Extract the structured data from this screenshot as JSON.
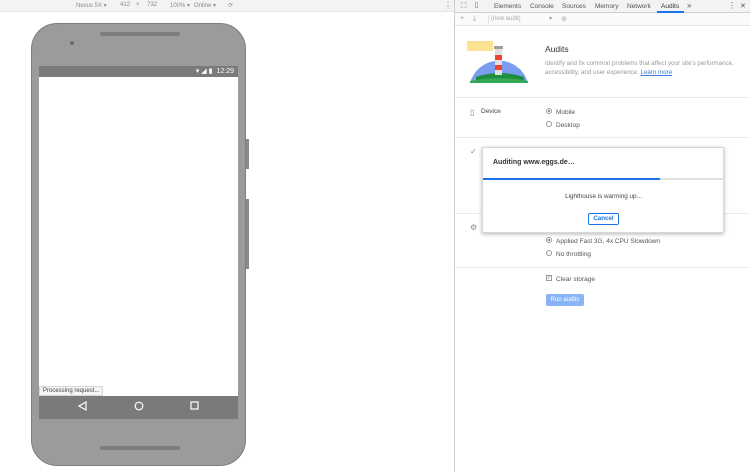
{
  "emulator": {
    "device": "Nexus 5X ▾",
    "width": "412",
    "times": "×",
    "height": "732",
    "zoom": "100% ▾",
    "network": "Online ▾",
    "rotate_icon": "rotate-icon",
    "menu": "⋮"
  },
  "phone": {
    "status_time": "12:29",
    "processing_text": "Processing request..."
  },
  "devtools": {
    "tabs": [
      {
        "label": "Elements"
      },
      {
        "label": "Console"
      },
      {
        "label": "Sources"
      },
      {
        "label": "Memory"
      },
      {
        "label": "Network"
      },
      {
        "label": "Audits"
      }
    ],
    "more_tabs": "»",
    "menu": "⋮",
    "close": "✕",
    "active_tab": "Audits",
    "accent": "#1a73e8"
  },
  "audits": {
    "select_placeholder": "(new audit)",
    "title": "Audits",
    "desc": "Identify and fix common problems that affect your site's performance, accessibility, and user experience.",
    "learn_more": "Learn more",
    "device_label": "Device",
    "device_options": [
      {
        "label": "Mobile",
        "checked": true
      },
      {
        "label": "Desktop",
        "checked": false
      }
    ],
    "throttling_options": [
      {
        "label": "Applied Fast 3G, 4x CPU Slowdown",
        "checked": true
      },
      {
        "label": "No throttling",
        "checked": false
      }
    ],
    "clear_storage": "Clear storage",
    "run_button": "Run audits"
  },
  "dialog": {
    "title": "Auditing www.eggs.de…",
    "message": "Lighthouse is warming up…",
    "cancel": "Cancel",
    "progress": 0.73
  }
}
